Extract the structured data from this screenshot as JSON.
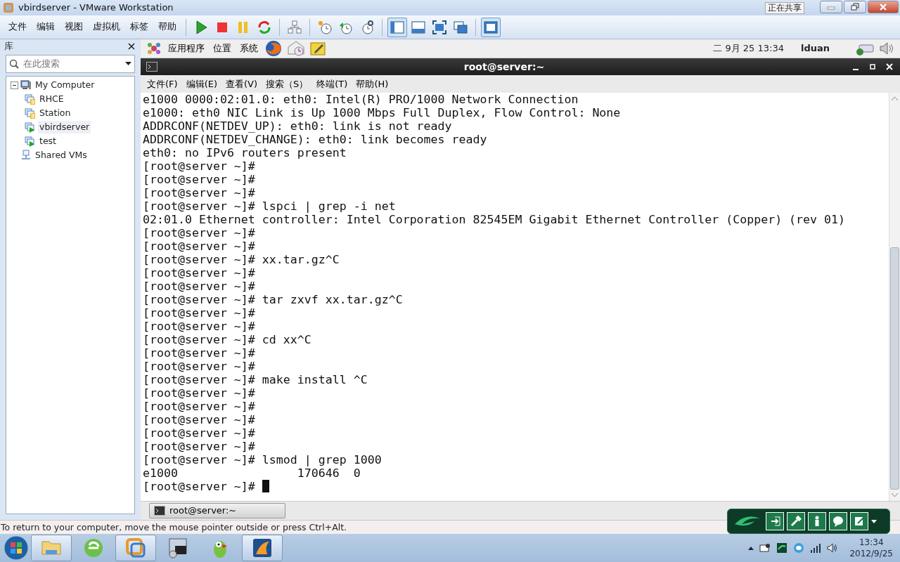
{
  "window": {
    "title": "vbirdserver - VMware Workstation"
  },
  "sharing_indicator": {
    "label": "正在共享"
  },
  "menu": [
    "文件",
    "编辑",
    "视图",
    "虚拟机",
    "标签",
    "帮助"
  ],
  "view_modes": [
    {
      "kind": "sidebar",
      "selected": true
    },
    {
      "kind": "bottom",
      "selected": false
    },
    {
      "kind": "fullscreen",
      "selected": false
    },
    {
      "kind": "unity",
      "selected": false
    }
  ],
  "console_view": {
    "selected": true
  },
  "library": {
    "title": "库",
    "search": {
      "placeholder": "在此搜索"
    },
    "tree": [
      {
        "label": "My Computer",
        "kind": "computer",
        "expanded": true,
        "children": [
          {
            "label": "RHCE",
            "kind": "vm",
            "running": false,
            "selected": false
          },
          {
            "label": "Station",
            "kind": "vm",
            "running": false,
            "selected": false
          },
          {
            "label": "vbirdserver",
            "kind": "vm",
            "running": true,
            "selected": true
          },
          {
            "label": "test",
            "kind": "vm",
            "running": true,
            "selected": false
          }
        ]
      },
      {
        "label": "Shared VMs",
        "kind": "shared"
      }
    ]
  },
  "guest": {
    "panel": {
      "menus": [
        "应用程序",
        "位置",
        "系统"
      ],
      "clock": "二 9月 25 13:34",
      "user": "lduan"
    },
    "terminal": {
      "title": "root@server:~",
      "menu": [
        "文件(F)",
        "编辑(E)",
        "查看(V)",
        "搜索（S）",
        "终端(T)",
        "帮助(H)"
      ],
      "lines": [
        "e1000 0000:02:01.0: eth0: Intel(R) PRO/1000 Network Connection",
        "e1000: eth0 NIC Link is Up 1000 Mbps Full Duplex, Flow Control: None",
        "ADDRCONF(NETDEV_UP): eth0: link is not ready",
        "ADDRCONF(NETDEV_CHANGE): eth0: link becomes ready",
        "eth0: no IPv6 routers present",
        "[root@server ~]#",
        "[root@server ~]#",
        "[root@server ~]#",
        "[root@server ~]# lspci | grep -i net",
        "02:01.0 Ethernet controller: Intel Corporation 82545EM Gigabit Ethernet Controller (Copper) (rev 01)",
        "[root@server ~]#",
        "[root@server ~]#",
        "[root@server ~]# xx.tar.gz^C",
        "[root@server ~]#",
        "[root@server ~]#",
        "[root@server ~]# tar zxvf xx.tar.gz^C",
        "[root@server ~]#",
        "[root@server ~]#",
        "[root@server ~]# cd xx^C",
        "[root@server ~]#",
        "[root@server ~]#",
        "[root@server ~]# make install ^C",
        "[root@server ~]#",
        "[root@server ~]#",
        "[root@server ~]#",
        "[root@server ~]#",
        "[root@server ~]#",
        "[root@server ~]# lsmod | grep 1000",
        "e1000                 170646  0",
        "[root@server ~]# "
      ]
    },
    "task_button": "root@server:~"
  },
  "status_bar": "To return to your computer, move the mouse pointer outside or press Ctrl+Alt.",
  "taskbar": {
    "apps": [
      {
        "kind": "folder",
        "selected": true
      },
      {
        "kind": "browser",
        "selected": false
      },
      {
        "kind": "vmware",
        "selected": true
      },
      {
        "kind": "lock",
        "selected": false
      },
      {
        "kind": "parrot",
        "selected": false
      },
      {
        "kind": "office",
        "selected": true
      }
    ],
    "time": "13:34",
    "date": "2012/9/25"
  }
}
